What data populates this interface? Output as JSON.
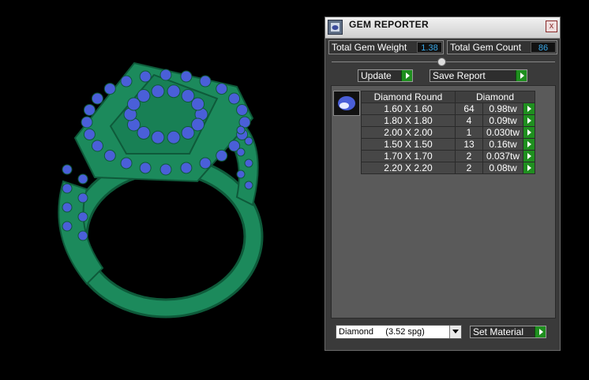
{
  "viewport": {
    "model_name": "ring-3d-model",
    "metal_color": "#1c8a5c",
    "stone_color": "#4a5fd8"
  },
  "panel": {
    "title": "GEM REPORTER",
    "close_glyph": "x",
    "total_weight_label": "Total Gem Weight",
    "total_weight_value": "1.38",
    "total_count_label": "Total Gem Count",
    "total_count_value": "86",
    "update_label": "Update",
    "save_report_label": "Save Report",
    "material_value": "Diamond     (3.52 spg)",
    "set_material_label": "Set Material"
  },
  "table": {
    "headers": [
      "Diamond Round",
      "Diamond"
    ],
    "rows": [
      {
        "size": "1.60 X 1.60",
        "count": "64",
        "weight": "0.98tw"
      },
      {
        "size": "1.80 X 1.80",
        "count": "4",
        "weight": "0.09tw"
      },
      {
        "size": "2.00 X 2.00",
        "count": "1",
        "weight": "0.030tw"
      },
      {
        "size": "1.50 X 1.50",
        "count": "13",
        "weight": "0.16tw"
      },
      {
        "size": "1.70 X 1.70",
        "count": "2",
        "weight": "0.037tw"
      },
      {
        "size": "2.20 X 2.20",
        "count": "2",
        "weight": "0.08tw"
      }
    ]
  },
  "colors": {
    "accent_green": "#1f8f1f",
    "value_blue": "#39a8e8",
    "panel_bg": "#3a3a3a"
  },
  "icons": [
    "gem-reporter-app-icon",
    "close-icon",
    "collapse-knob-icon",
    "play-arrow-icon",
    "gem-oval-icon",
    "chevron-down-icon"
  ]
}
